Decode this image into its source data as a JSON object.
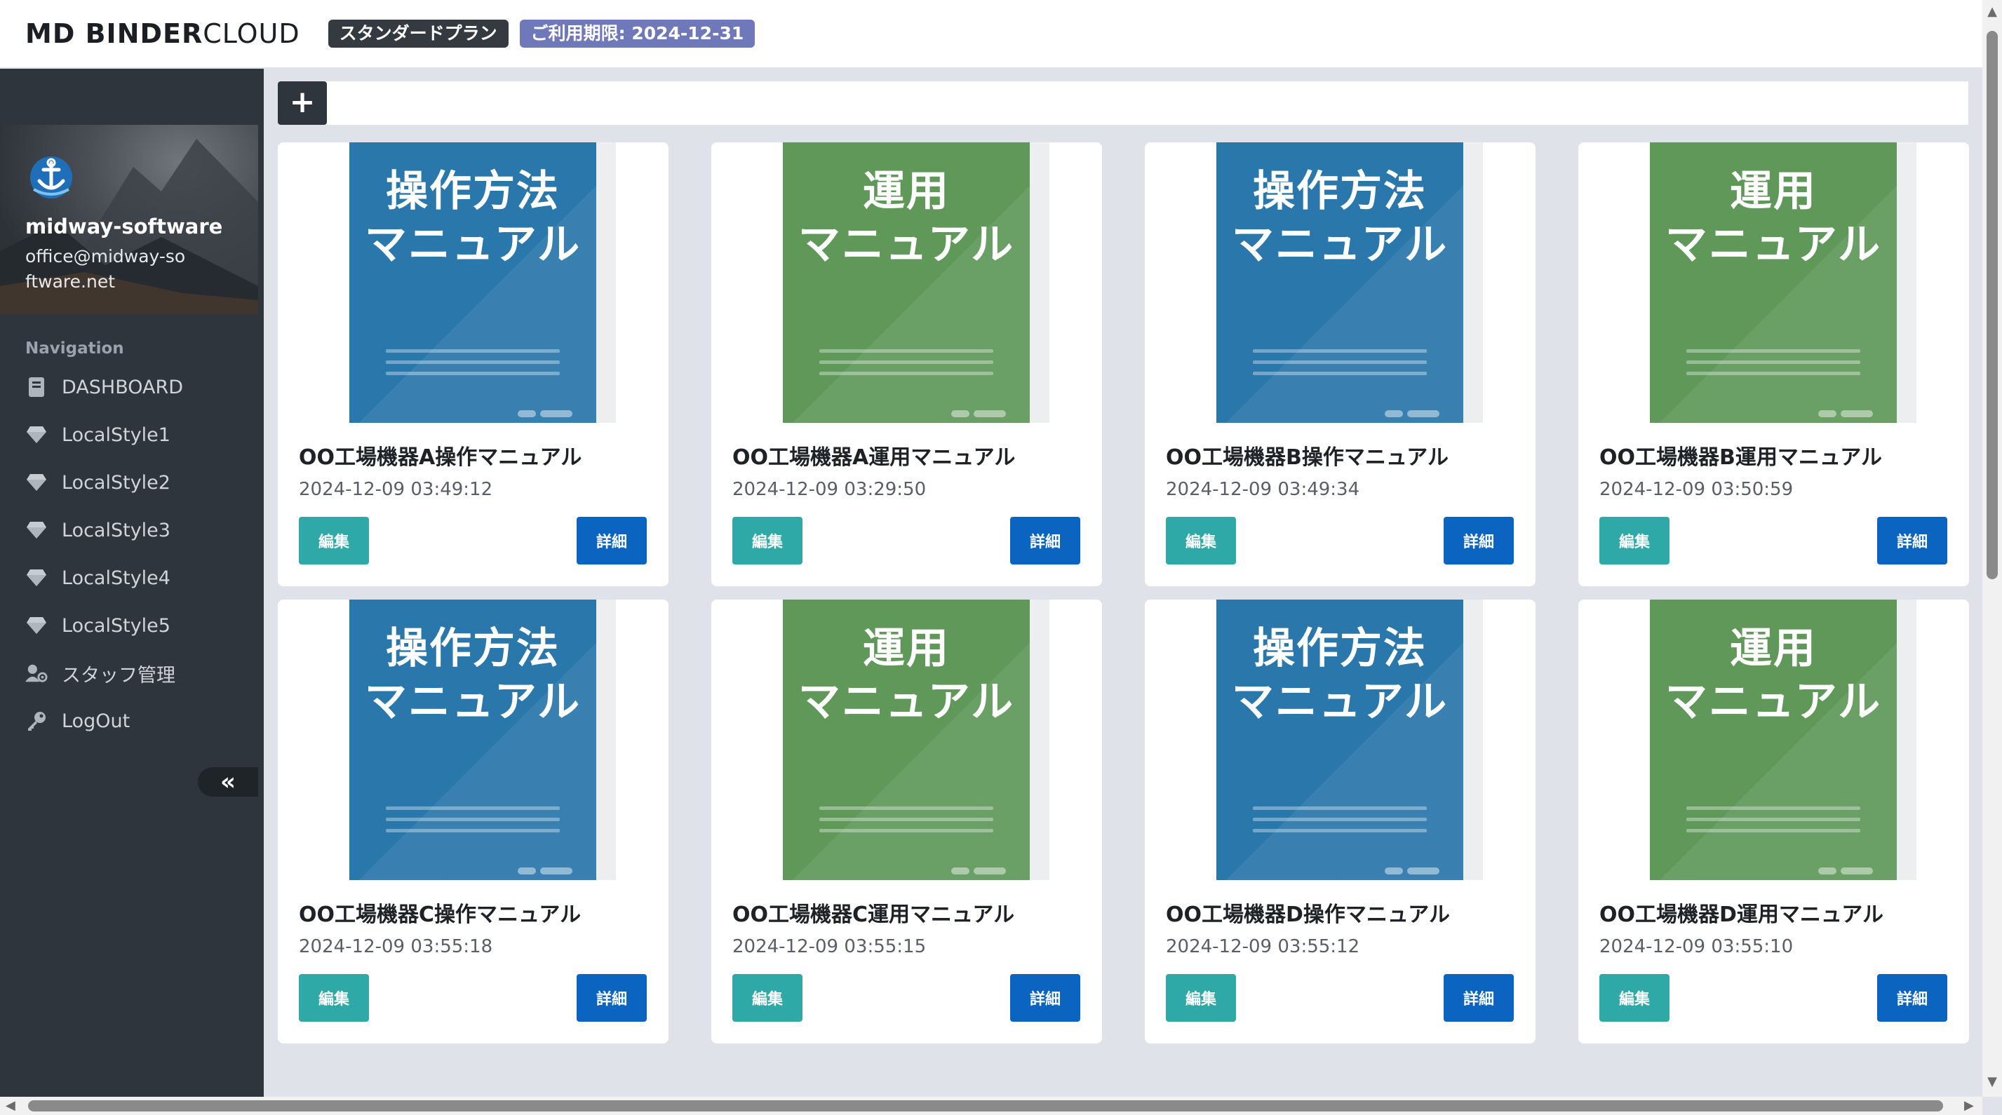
{
  "header": {
    "brand_bold": "MD BINDER",
    "brand_light": "CLOUD",
    "plan_badge": "スタンダードプラン",
    "limit_badge": "ご利用期限: 2024-12-31"
  },
  "profile": {
    "name": "midway-software",
    "email": "office@midway-software.net"
  },
  "nav": {
    "heading": "Navigation",
    "items": [
      {
        "label": "DASHBOARD",
        "icon": "book-icon"
      },
      {
        "label": "LocalStyle1",
        "icon": "gem-icon"
      },
      {
        "label": "LocalStyle2",
        "icon": "gem-icon"
      },
      {
        "label": "LocalStyle3",
        "icon": "gem-icon"
      },
      {
        "label": "LocalStyle4",
        "icon": "gem-icon"
      },
      {
        "label": "LocalStyle5",
        "icon": "gem-icon"
      },
      {
        "label": "スタッフ管理",
        "icon": "user-gear-icon"
      },
      {
        "label": "LogOut",
        "icon": "key-icon"
      }
    ],
    "collapse_icon": "«"
  },
  "toolbar": {
    "add_label": "+"
  },
  "buttons": {
    "edit": "編集",
    "detail": "詳細"
  },
  "manuals": [
    {
      "title": "OO工場機器A操作マニュアル",
      "date": "2024-12-09 03:49:12",
      "cover_text": "操作方法\nマニュアル",
      "cover_color": "blue"
    },
    {
      "title": "OO工場機器A運用マニュアル",
      "date": "2024-12-09 03:29:50",
      "cover_text": "運用\nマニュアル",
      "cover_color": "green"
    },
    {
      "title": "OO工場機器B操作マニュアル",
      "date": "2024-12-09 03:49:34",
      "cover_text": "操作方法\nマニュアル",
      "cover_color": "blue"
    },
    {
      "title": "OO工場機器B運用マニュアル",
      "date": "2024-12-09 03:50:59",
      "cover_text": "運用\nマニュアル",
      "cover_color": "green"
    },
    {
      "title": "OO工場機器C操作マニュアル",
      "date": "2024-12-09 03:55:18",
      "cover_text": "操作方法\nマニュアル",
      "cover_color": "blue"
    },
    {
      "title": "OO工場機器C運用マニュアル",
      "date": "2024-12-09 03:55:15",
      "cover_text": "運用\nマニュアル",
      "cover_color": "green"
    },
    {
      "title": "OO工場機器D操作マニュアル",
      "date": "2024-12-09 03:55:12",
      "cover_text": "操作方法\nマニュアル",
      "cover_color": "blue"
    },
    {
      "title": "OO工場機器D運用マニュアル",
      "date": "2024-12-09 03:55:10",
      "cover_text": "運用\nマニュアル",
      "cover_color": "green"
    }
  ],
  "colors": {
    "cover_blue": "#2a77ab",
    "cover_green": "#5f9859",
    "edit_button": "#2fa9a8",
    "detail_button": "#0c64c1",
    "sidebar": "#2e353d",
    "limit_badge": "#6f79b9"
  }
}
